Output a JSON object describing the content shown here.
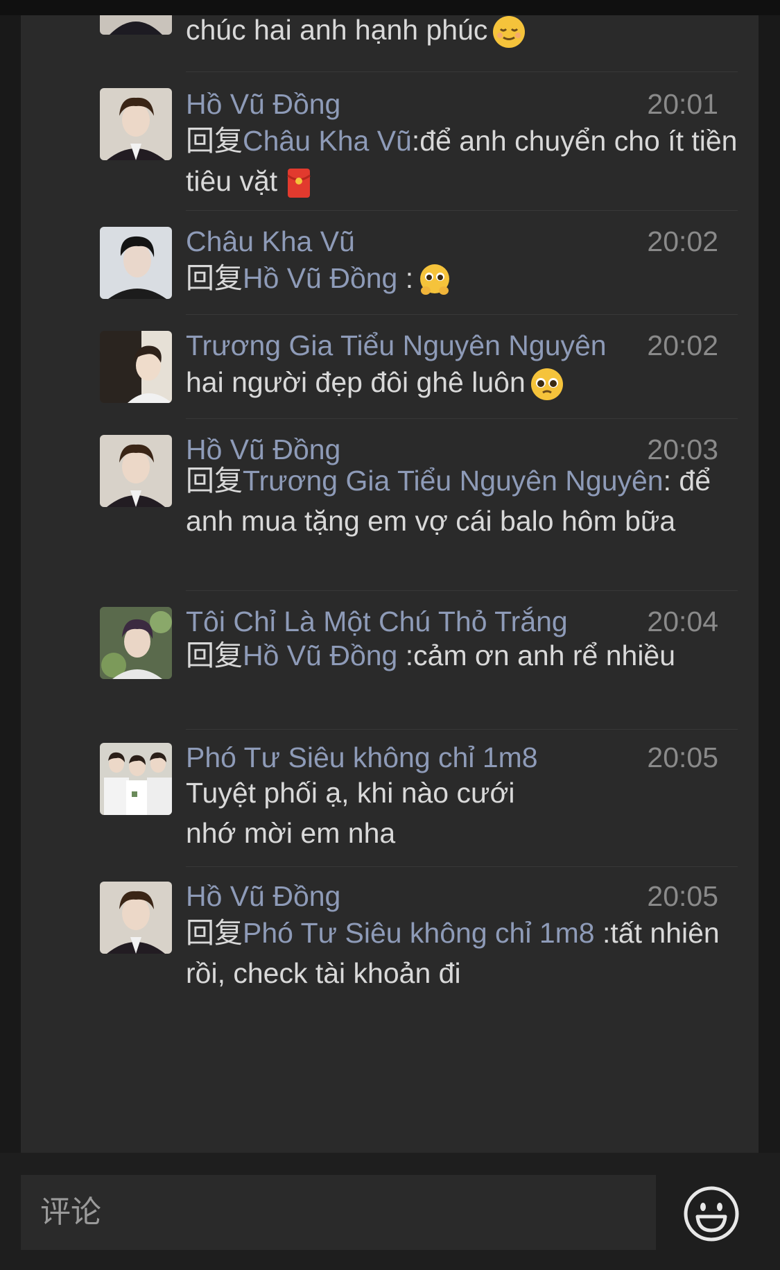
{
  "comments": [
    {
      "name": "",
      "time": "",
      "text": "chúc hai anh hạnh phúc",
      "emoji": "relieved-face-icon"
    },
    {
      "name": "Hồ Vũ Đồng",
      "time": "20:01",
      "reply_prefix": "回复",
      "reply_to": "Châu Kha Vũ",
      "text": ":để anh chuyển cho ít tiền tiêu vặt",
      "emoji": "red-envelope-icon"
    },
    {
      "name": "Châu Kha Vũ",
      "time": "20:02",
      "reply_prefix": "回复",
      "reply_to": "Hồ Vũ Đồng",
      "text": " :",
      "emoji": "pleading-hands-face-icon"
    },
    {
      "name": "Trương Gia Tiểu Nguyên Nguyên",
      "time": "20:02",
      "text": "hai người đẹp đôi ghê luôn",
      "emoji": "pleading-face-icon"
    },
    {
      "name": "Hồ Vũ Đồng",
      "time": "20:03",
      "reply_prefix": "回复",
      "reply_to": "Trương Gia Tiểu Nguyên Nguyên",
      "text": ": để anh mua tặng em vợ cái balo hôm bữa"
    },
    {
      "name": "Tôi Chỉ Là Một Chú Thỏ Trắng",
      "time": "20:04",
      "reply_prefix": "回复",
      "reply_to": "Hồ Vũ Đồng",
      "text": " :cảm ơn anh rể nhiều"
    },
    {
      "name": "Phó Tư Siêu không chỉ 1m8",
      "time": "20:05",
      "text": "Tuyệt phối ạ, khi nào cưới nhớ mời em nha"
    },
    {
      "name": "Hồ Vũ Đồng",
      "time": "20:05",
      "reply_prefix": "回复",
      "reply_to": "Phó Tư Siêu không chỉ 1m8",
      "text": " :tất nhiên rồi, check tài khoản đi"
    }
  ],
  "input": {
    "placeholder": "评论"
  },
  "emoji_button_icon": "smiley-face-icon",
  "colors": {
    "background": "#2a2a2a",
    "name": "#8e9bb8",
    "text": "#d9d9d9",
    "time": "#8a8a8a"
  }
}
